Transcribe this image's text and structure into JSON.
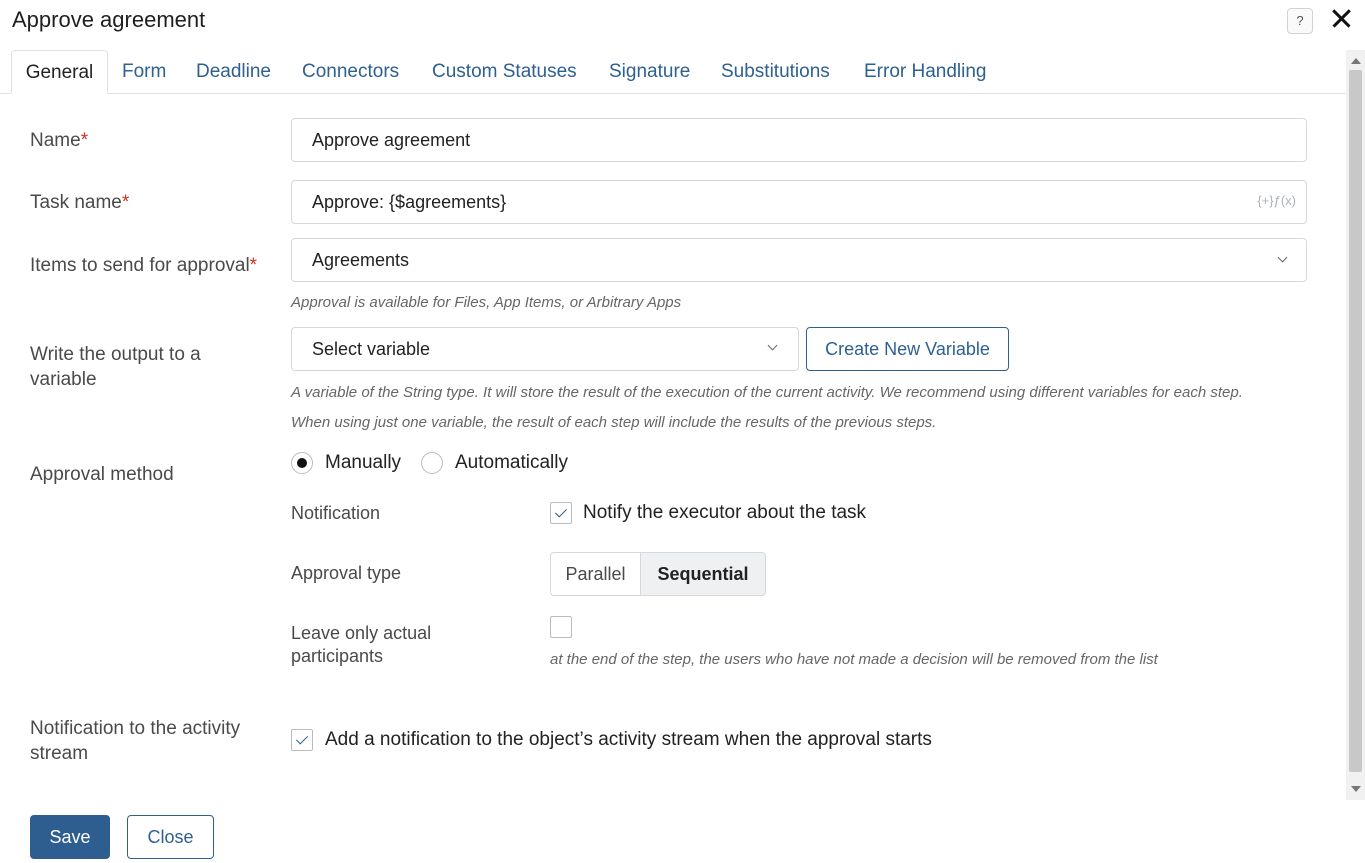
{
  "dialog": {
    "title": "Approve agreement",
    "help_glyph": "?",
    "help_icon": "help-icon",
    "close_icon": "close-icon"
  },
  "tabs": [
    {
      "label": "General",
      "active": true
    },
    {
      "label": "Form"
    },
    {
      "label": "Deadline"
    },
    {
      "label": "Connectors"
    },
    {
      "label": "Custom Statuses"
    },
    {
      "label": "Signature"
    },
    {
      "label": "Substitutions"
    },
    {
      "label": "Error Handling"
    }
  ],
  "form": {
    "name": {
      "label": "Name",
      "required_mark": "*",
      "value": "Approve agreement"
    },
    "task_name": {
      "label": "Task name",
      "required_mark": "*",
      "value": "Approve: {$agreements}",
      "insert_glyph": "{+}ƒ(x)"
    },
    "items": {
      "label": "Items to send for approval",
      "required_mark": "*",
      "value": "Agreements",
      "hint": "Approval is available for Files, App Items, or Arbitrary Apps"
    },
    "output": {
      "label_line1": "Write the output to a",
      "label_line2": "variable",
      "value": "Select variable",
      "create_button": "Create New Variable",
      "hint_line1": "A variable of the String type. It will store the result of the execution of the current activity. We recommend using different variables for each step.",
      "hint_line2": "When using just one variable, the result of each step will include the results of the previous steps."
    },
    "approval_method": {
      "label": "Approval method",
      "options": [
        "Manually",
        "Automatically"
      ],
      "selected": "Manually"
    },
    "notification": {
      "label": "Notification",
      "checkbox_label": "Notify the executor about the task",
      "checked": true
    },
    "approval_type": {
      "label": "Approval type",
      "options": [
        "Parallel",
        "Sequential"
      ],
      "selected": "Sequential"
    },
    "leave_actual": {
      "label_line1": "Leave only actual",
      "label_line2": "participants",
      "checked": false,
      "hint": "at the end of the step, the users who have not made a decision will be removed from the list"
    },
    "activity_stream": {
      "label_line1": "Notification to the activity",
      "label_line2": "stream",
      "checkbox_label": "Add a notification to the object’s activity stream when the approval starts",
      "checked": true
    }
  },
  "footer": {
    "save_label": "Save",
    "close_label": "Close"
  }
}
